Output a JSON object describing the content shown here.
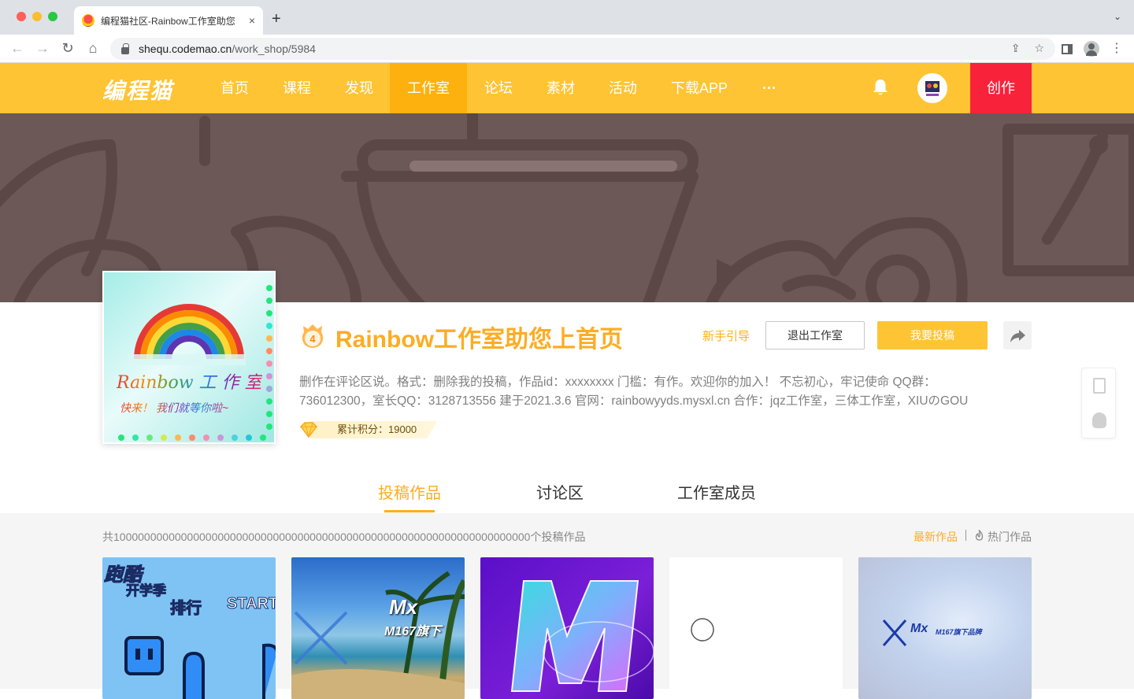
{
  "browser": {
    "tab_title": "编程猫社区-Rainbow工作室助您",
    "tab_close": "×",
    "new_tab": "+",
    "tab_menu": "⌄",
    "url_host": "shequ.codemao.cn",
    "url_path": "/work_shop/5984"
  },
  "header": {
    "logo": "编程猫",
    "nav": [
      {
        "label": "首页"
      },
      {
        "label": "课程"
      },
      {
        "label": "发现"
      },
      {
        "label": "工作室",
        "active": true
      },
      {
        "label": "论坛"
      },
      {
        "label": "素材"
      },
      {
        "label": "活动"
      },
      {
        "label": "下载APP"
      },
      {
        "label": "···"
      }
    ],
    "create_label": "创作"
  },
  "studio": {
    "cover_text_1": "Rainbow 工 作 室",
    "cover_text_2": "快来！ 我们就等你啦~",
    "level": "4",
    "title": "Rainbow工作室助您上首页",
    "guide_label": "新手引导",
    "quit_label": "退出工作室",
    "submit_label": "我要投稿",
    "description": "删作在评论区说。格式：删除我的投稿，作品id：xxxxxxxx 门槛：有作。欢迎你的加入！ 不忘初心，牢记使命 QQ群：736012300，室长QQ：3128713556 建于2021.3.6 官网：rainbowyyds.mysxl.cn 合作：jqz工作室，三体工作室，XIUのGOU",
    "score_label": "累计积分：19000"
  },
  "tabs": [
    {
      "label": "投稿作品",
      "active": true
    },
    {
      "label": "讨论区"
    },
    {
      "label": "工作室成员"
    }
  ],
  "works": {
    "count_text": "共10000000000000000000000000000000000000000000000000000000000000000000个投稿作品",
    "sort_new": "最新作品",
    "sort_hot": "热门作品",
    "cards": [
      {
        "t1": "跑酷",
        "t2": "开学季",
        "t3": "排行",
        "t4": "START"
      },
      {
        "t1": "Mx",
        "t2": "M167旗下"
      },
      {
        "t1": "M"
      },
      {
        "t1": ""
      },
      {
        "t1": "Mx",
        "t2": "M167旗下品牌"
      }
    ]
  },
  "colors": {
    "brand_yellow": "#fec433",
    "nav_active": "#fdb10f",
    "create_red": "#f8223a",
    "title_orange": "#fdac23"
  }
}
